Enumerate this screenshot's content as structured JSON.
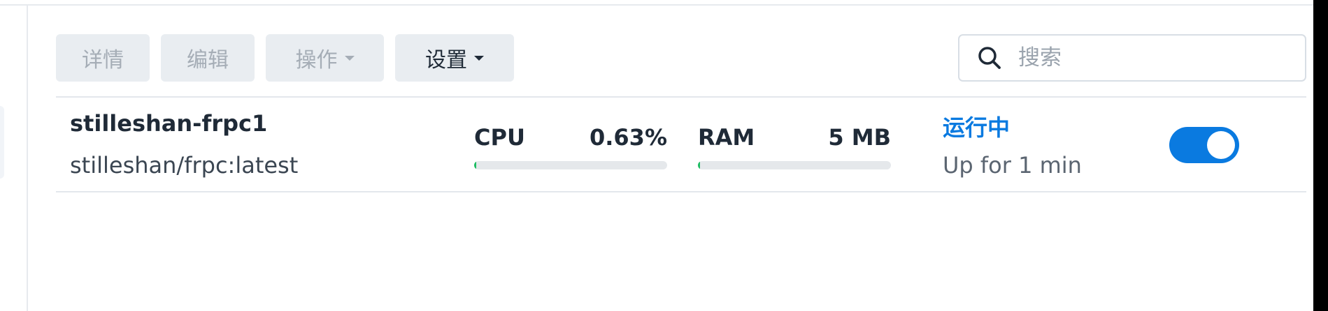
{
  "toolbar": {
    "details_label": "详情",
    "edit_label": "编辑",
    "action_label": "操作",
    "settings_label": "设置"
  },
  "search": {
    "placeholder": "搜索",
    "value": ""
  },
  "containers": [
    {
      "name": "stilleshan-frpc1",
      "image": "stilleshan/frpc:latest",
      "cpu_label": "CPU",
      "cpu_value": "0.63%",
      "cpu_fraction": 0.0063,
      "ram_label": "RAM",
      "ram_value": "5 MB",
      "ram_fraction": 0.01,
      "status": "运行中",
      "uptime": "Up for 1 min",
      "enabled": true
    }
  ],
  "colors": {
    "accent": "#0a7ae0",
    "usage_bar": "#1dbd63",
    "button_bg": "#e9edf1",
    "disabled_text": "#a5adb6"
  },
  "icons": {
    "search": "magnifier-icon",
    "dropdown": "caret-down-icon"
  }
}
